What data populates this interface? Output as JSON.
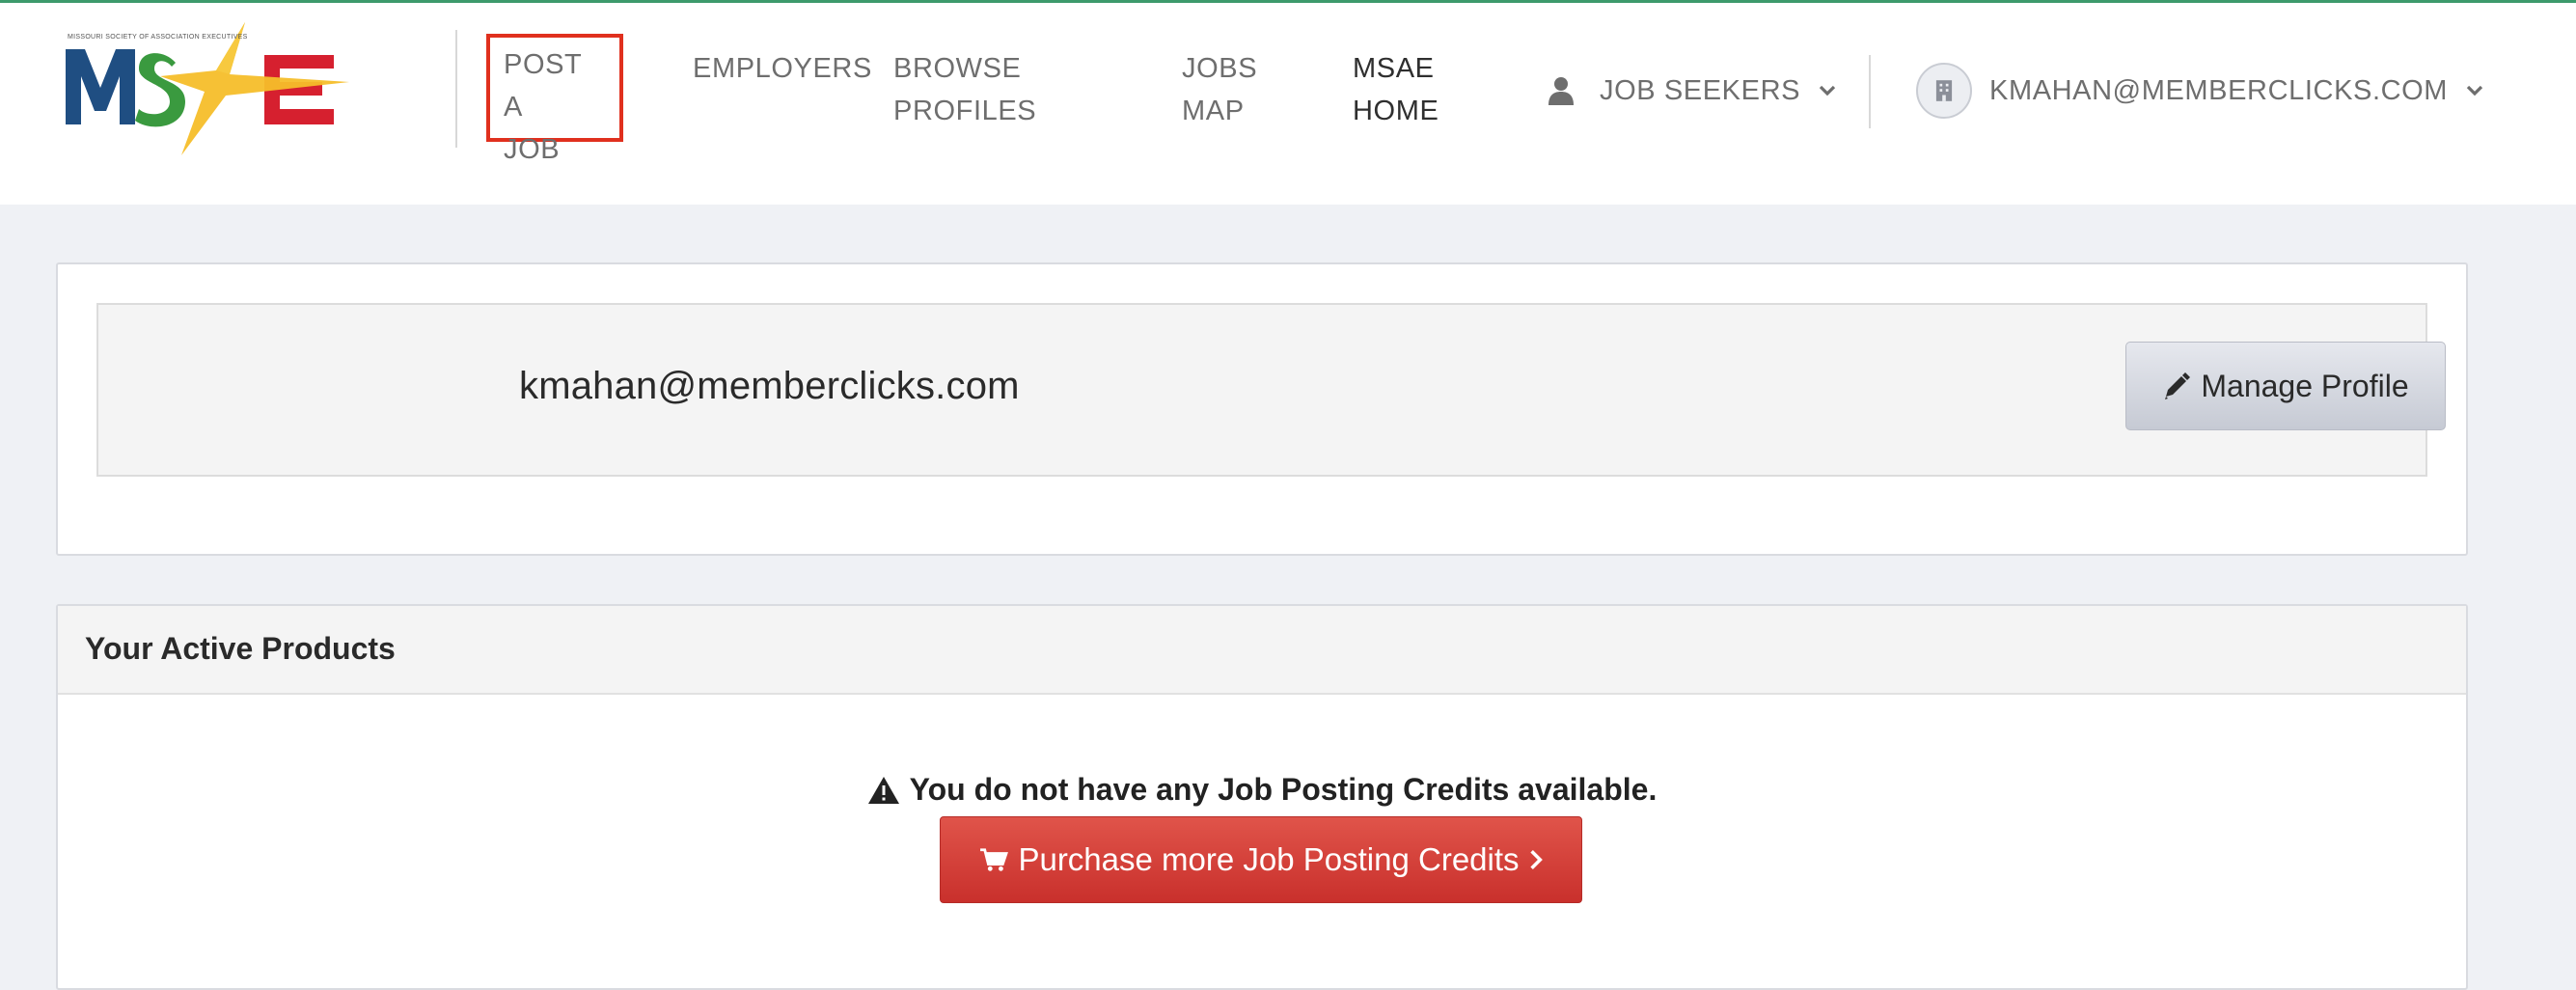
{
  "brand": {
    "logo_text": "MSAE",
    "tagline": "MISSOURI SOCIETY OF ASSOCIATION EXECUTIVES"
  },
  "nav": {
    "post_job_line1": "POST A",
    "post_job_line2": "JOB",
    "employers": "EMPLOYERS",
    "browse_line1": "BROWSE",
    "browse_line2": "PROFILES",
    "jobs_map_line1": "JOBS",
    "jobs_map_line2": "MAP",
    "msae_home_line1": "MSAE",
    "msae_home_line2": "HOME",
    "job_seekers": "JOB SEEKERS",
    "account_email": "KMAHAN@MEMBERCLICKS.COM"
  },
  "profile": {
    "email": "kmahan@memberclicks.com",
    "manage_button": "Manage Profile"
  },
  "products": {
    "title": "Your Active Products",
    "warning": "You do not have any Job Posting Credits available.",
    "purchase_button": "Purchase more Job Posting Credits"
  },
  "colors": {
    "top_border": "#3d9a6c",
    "highlight_border": "#e0301e",
    "purchase_button": "#c9302c",
    "page_background": "#eff1f5"
  },
  "icons": {
    "user": "user-icon",
    "chevron": "chevron-down-icon",
    "building": "building-icon",
    "pencil": "pencil-icon",
    "warning": "warning-icon",
    "cart": "cart-icon",
    "chevron_right": "chevron-right-icon"
  }
}
